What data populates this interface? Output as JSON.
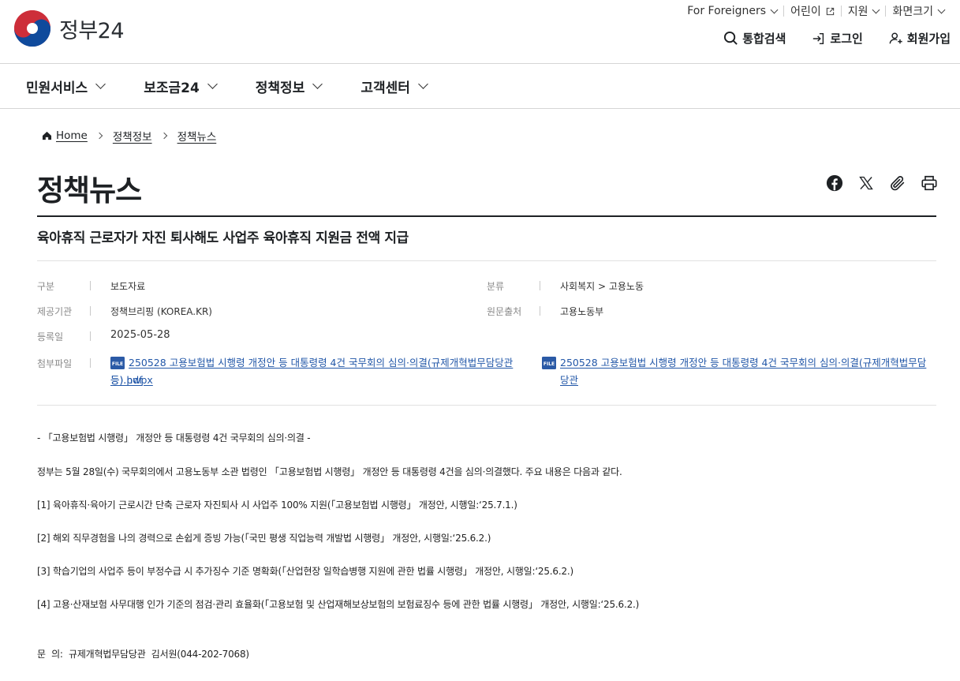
{
  "header": {
    "logo_text": "정부24",
    "util": [
      {
        "label": "For Foreigners"
      },
      {
        "label": "어린이"
      },
      {
        "label": "지원"
      },
      {
        "label": "화면크기"
      }
    ],
    "actions": {
      "search": "통합검색",
      "login": "로그인",
      "signup": "회원가입"
    }
  },
  "gnb": [
    {
      "label": "민원서비스"
    },
    {
      "label": "보조금24"
    },
    {
      "label": "정책정보"
    },
    {
      "label": "고객센터"
    }
  ],
  "breadcrumb": {
    "home": "Home",
    "level1": "정책정보",
    "level2": "정책뉴스"
  },
  "page_title": "정책뉴스",
  "article": {
    "title": "육아휴직 근로자가 자진 퇴사해도 사업주 육아휴직 지원금 전액 지급",
    "meta": {
      "type_label": "구분",
      "type_value": "보도자료",
      "category_label": "분류",
      "category_value": "사회복지 > 고용노동",
      "provider_label": "제공기관",
      "provider_value": "정책브리핑 (KOREA.KR)",
      "source_label": "원문출처",
      "source_value": "고용노동부",
      "date_label": "등록일",
      "date_value": "2025-05-28",
      "files_label": "첨부파일"
    },
    "files": [
      {
        "name_line1": "250528 고용보험법 시행령 개정안 등 대통령령 4건 국무회의 심의·의결(규제개혁법무담당관 등).hwpx",
        "name_line2": ""
      },
      {
        "name_line1": "250528 고용보험법 시행령 개정안 등 대통령령 4건 국무회의 심의·의결(규제개혁법무담당관",
        "name_line2": "등).pdf"
      }
    ],
    "file_badge": "FILE",
    "body": [
      "- 「고용보험법 시행령」 개정안 등 대통령령 4건 국무회의 심의·의결 -",
      "정부는 5월 28일(수) 국무회의에서 고용노동부 소관 법령인 「고용보험법 시행령」 개정안 등 대통령령 4건을 심의·의결했다. 주요 내용은 다음과 같다.",
      "[1] 육아휴직·육아기 근로시간 단축 근로자 자진퇴사 시 사업주 100% 지원(「고용보험법 시행령」 개정안, 시행일:‘25.7.1.)",
      "[2] 해외 직무경험을 나의 경력으로 손쉽게 증빙 가능(「국민 평생 직업능력 개발법 시행령」 개정안, 시행일:‘25.6.2.)",
      "[3] 학습기업의 사업주 등이 부정수급 시 추가징수 기준 명확화(「산업현장 일학습병행 지원에 관한 법률 시행령」 개정안, 시행일:‘25.6.2.)",
      "[4] 고용·산재보험 사무대행 인가 기준의 점검·관리 효율화(「고용보험 및 산업재해보상보험의 보험료징수 등에 관한 법률 시행령」 개정안, 시행일:‘25.6.2.)",
      "문  의:  규제개혁법무담당관  김서원(044-202-7068)"
    ]
  }
}
